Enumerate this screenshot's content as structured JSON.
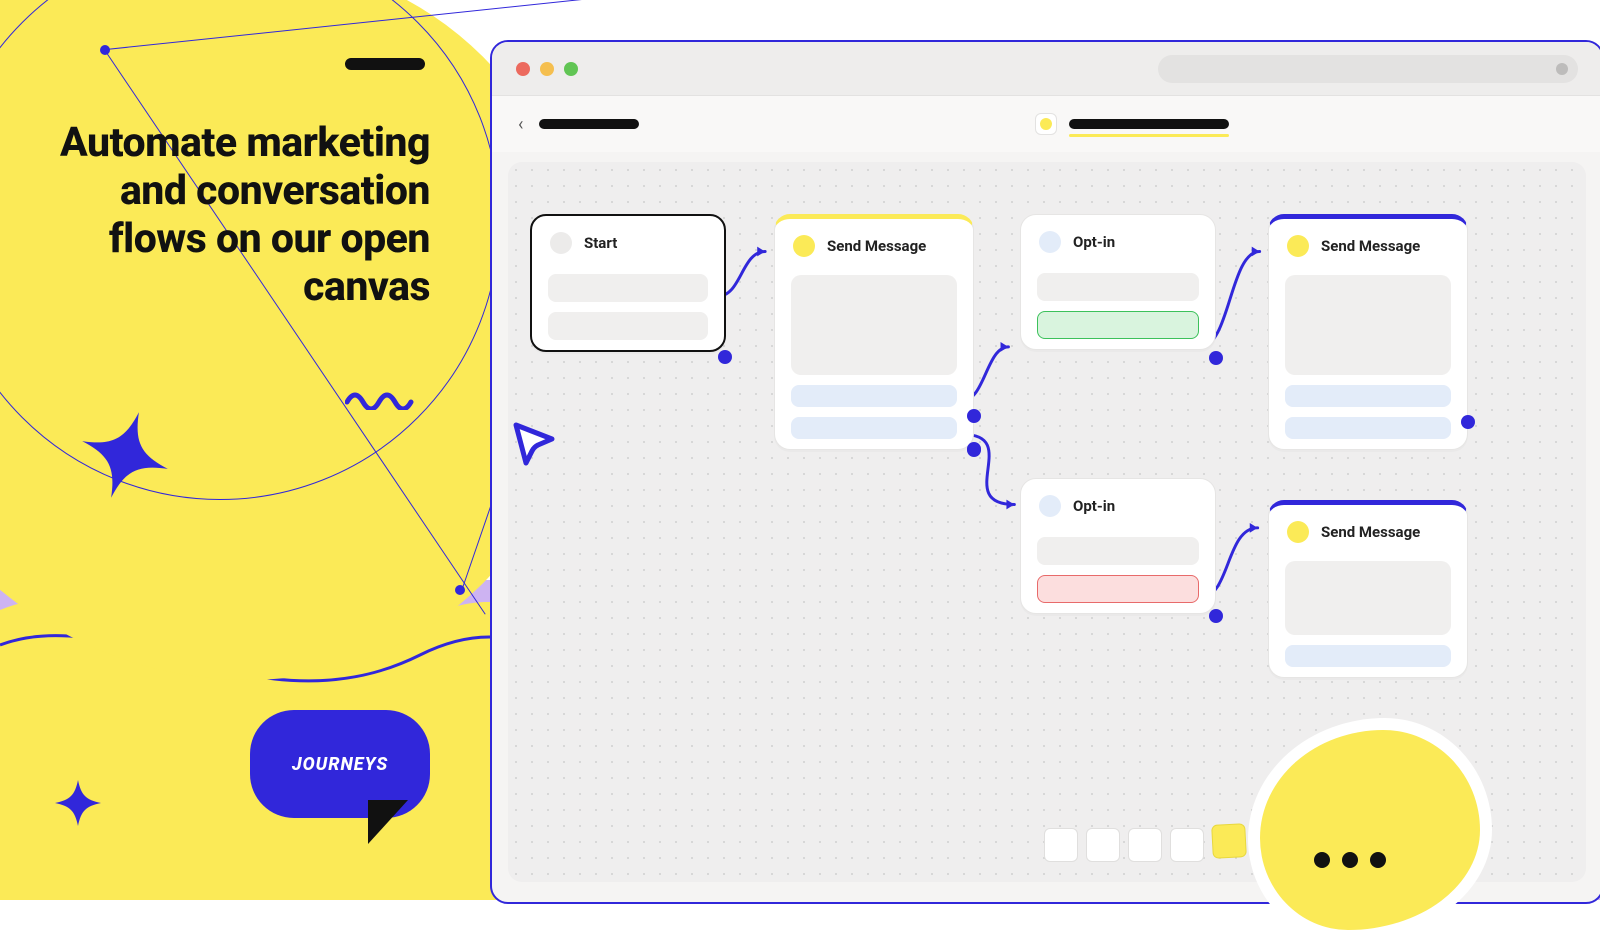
{
  "hero": {
    "headline": "Automate marketing and conversation flows on our open canvas",
    "badge": "JOURNEYS"
  },
  "browser": {
    "traffic_lights": {
      "red": "#ec6a5e",
      "amber": "#f5bf4f",
      "green": "#61c554"
    }
  },
  "nodes": {
    "start": {
      "title": "Start",
      "accent": "#d9d8d7"
    },
    "send1": {
      "title": "Send Message",
      "accent": "#fbea57"
    },
    "opt1": {
      "title": "Opt-in",
      "accent": "#e3ecf9"
    },
    "send2": {
      "title": "Send Message",
      "accent": "#fbea57"
    },
    "opt2": {
      "title": "Opt-in",
      "accent": "#e3ecf9"
    },
    "send3": {
      "title": "Send Message",
      "accent": "#fbea57"
    }
  },
  "colors": {
    "primary": "#3127da",
    "yellow": "#fbea57",
    "lilac": "#cdb3f2"
  }
}
